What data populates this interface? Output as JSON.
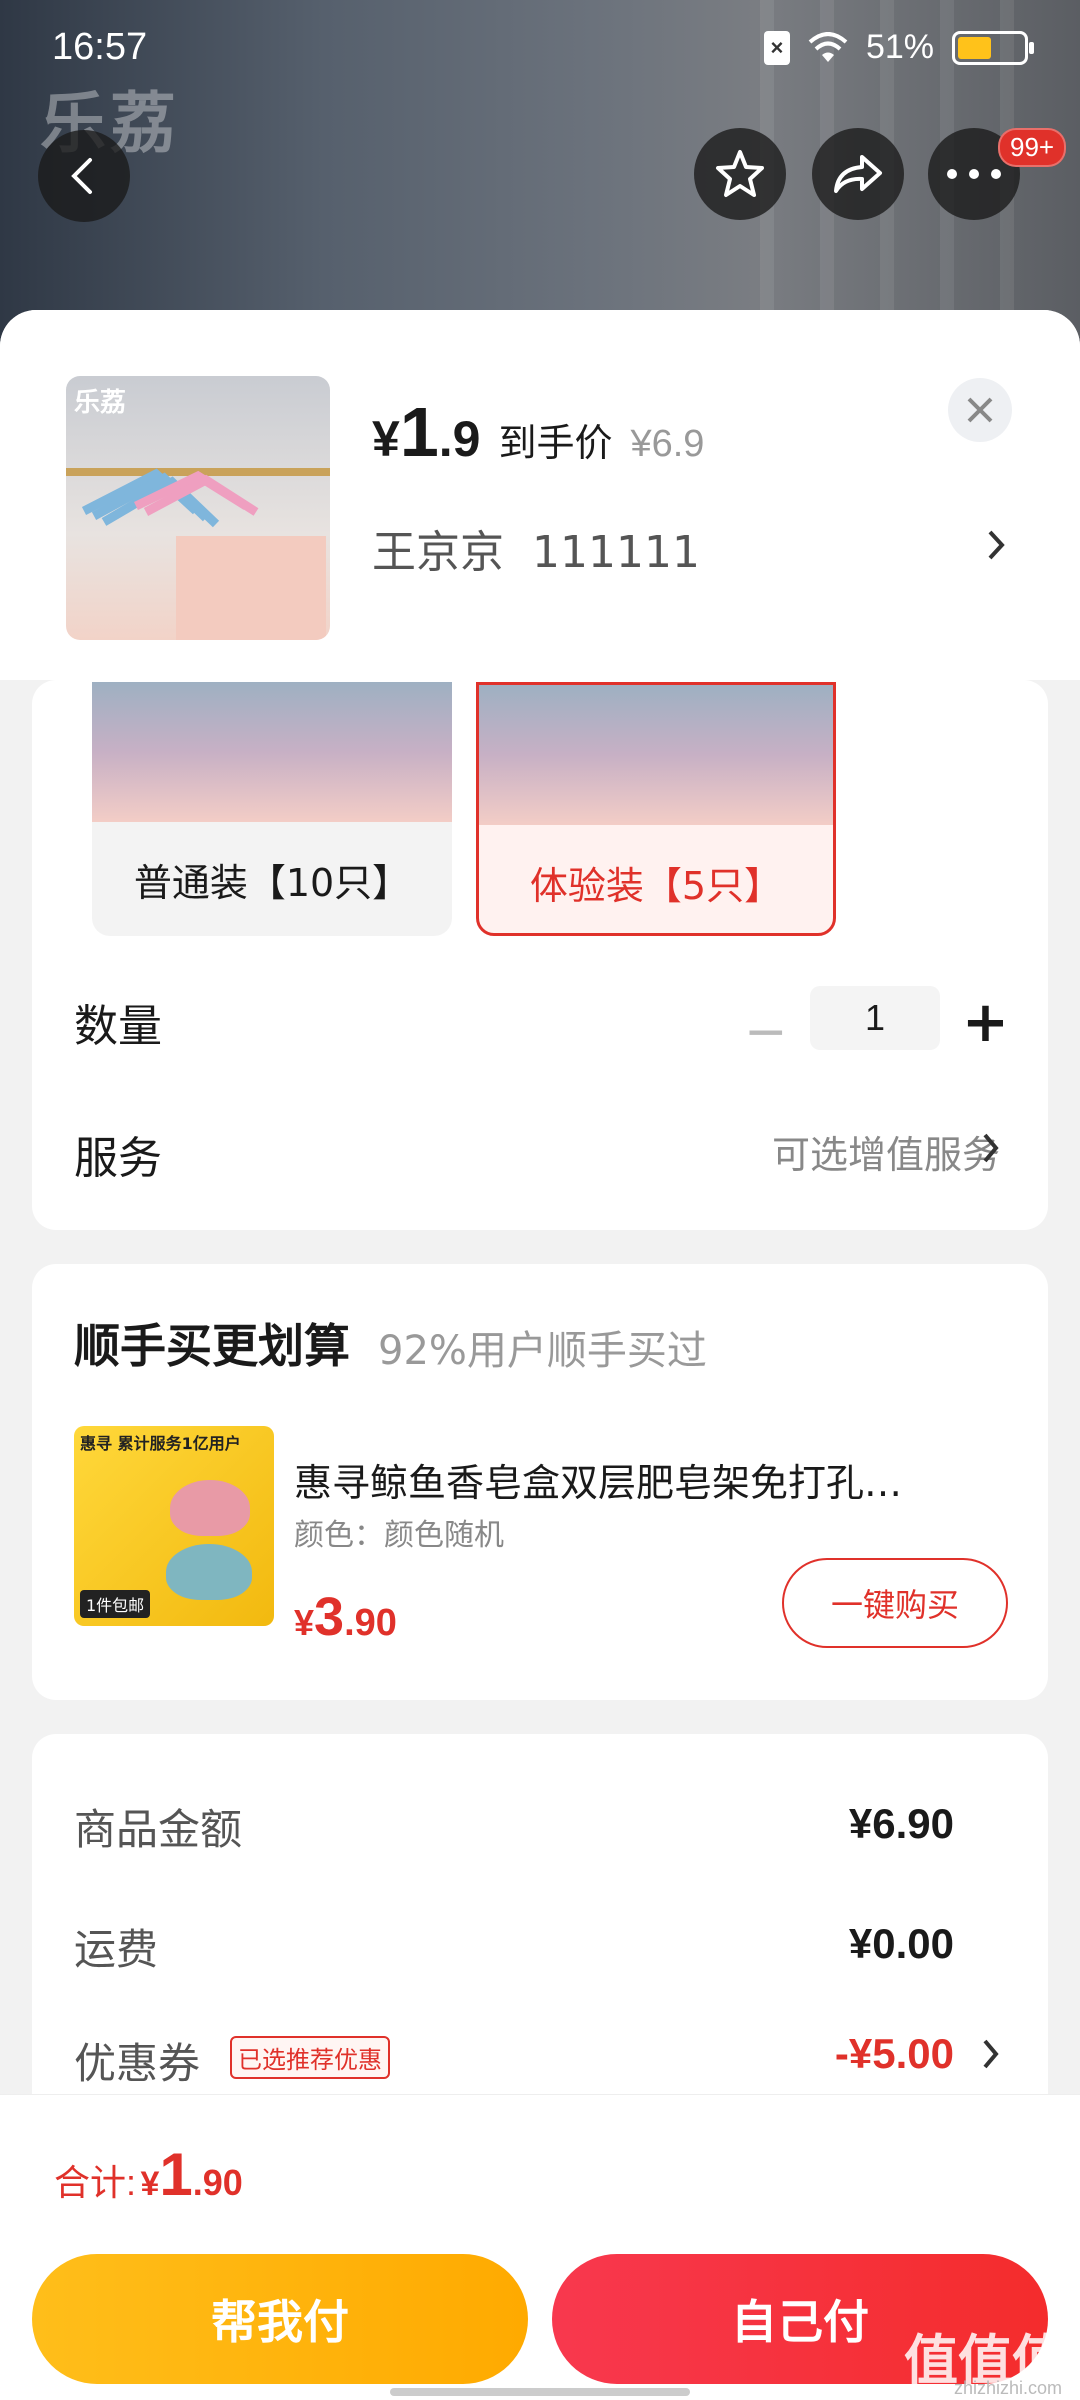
{
  "status_bar": {
    "time": "16:57",
    "battery": "51%",
    "battery_level": 0.51
  },
  "hero": {
    "watermark": "乐荔"
  },
  "top_actions": {
    "notification_count": "99+",
    "icons": [
      "back-icon",
      "star-icon",
      "share-icon",
      "more-icon"
    ]
  },
  "product": {
    "thumb_logo": "乐荔",
    "price_yen": "¥",
    "price_int": "1",
    "price_dec": ".9",
    "price_tag": "到手价",
    "original_price": "¥6.9",
    "address_name": "王京京",
    "address_phone": "111111"
  },
  "variants": [
    {
      "label": "普通装【10只】",
      "selected": false
    },
    {
      "label": "体验装【5只】",
      "selected": true
    }
  ],
  "quantity": {
    "label": "数量",
    "value": "1",
    "minus": "−",
    "plus": "+"
  },
  "service": {
    "label": "服务",
    "value": "可选增值服务"
  },
  "addon": {
    "title": "顺手买更划算",
    "subtitle": "92%用户顺手买过",
    "image_tag": "惠寻 累计服务1亿用户",
    "image_footer": "1件包邮",
    "product_title": "惠寻鲸鱼香皂盒双层肥皂架免打孔…",
    "spec": "颜色：颜色随机",
    "price_yen": "¥",
    "price_int": "3",
    "price_dec": ".90",
    "buy_label": "一键购买"
  },
  "summary": {
    "goods_label": "商品金额",
    "goods_value": "¥6.90",
    "shipping_label": "运费",
    "shipping_value": "¥0.00",
    "coupon_label": "优惠券",
    "coupon_tag": "已选推荐优惠",
    "coupon_value": "-¥5.00"
  },
  "footer": {
    "total_label": "合计:",
    "total_yen": "¥",
    "total_int": "1",
    "total_dec": ".90",
    "help_pay": "帮我付",
    "self_pay": "自己付"
  },
  "watermark_site": {
    "mark": "值值值",
    "url": "zhizhizhi.com"
  },
  "colors": {
    "accent_red": "#e0312a",
    "help_btn": "#ffb20a",
    "self_btn": "#f6343e"
  }
}
